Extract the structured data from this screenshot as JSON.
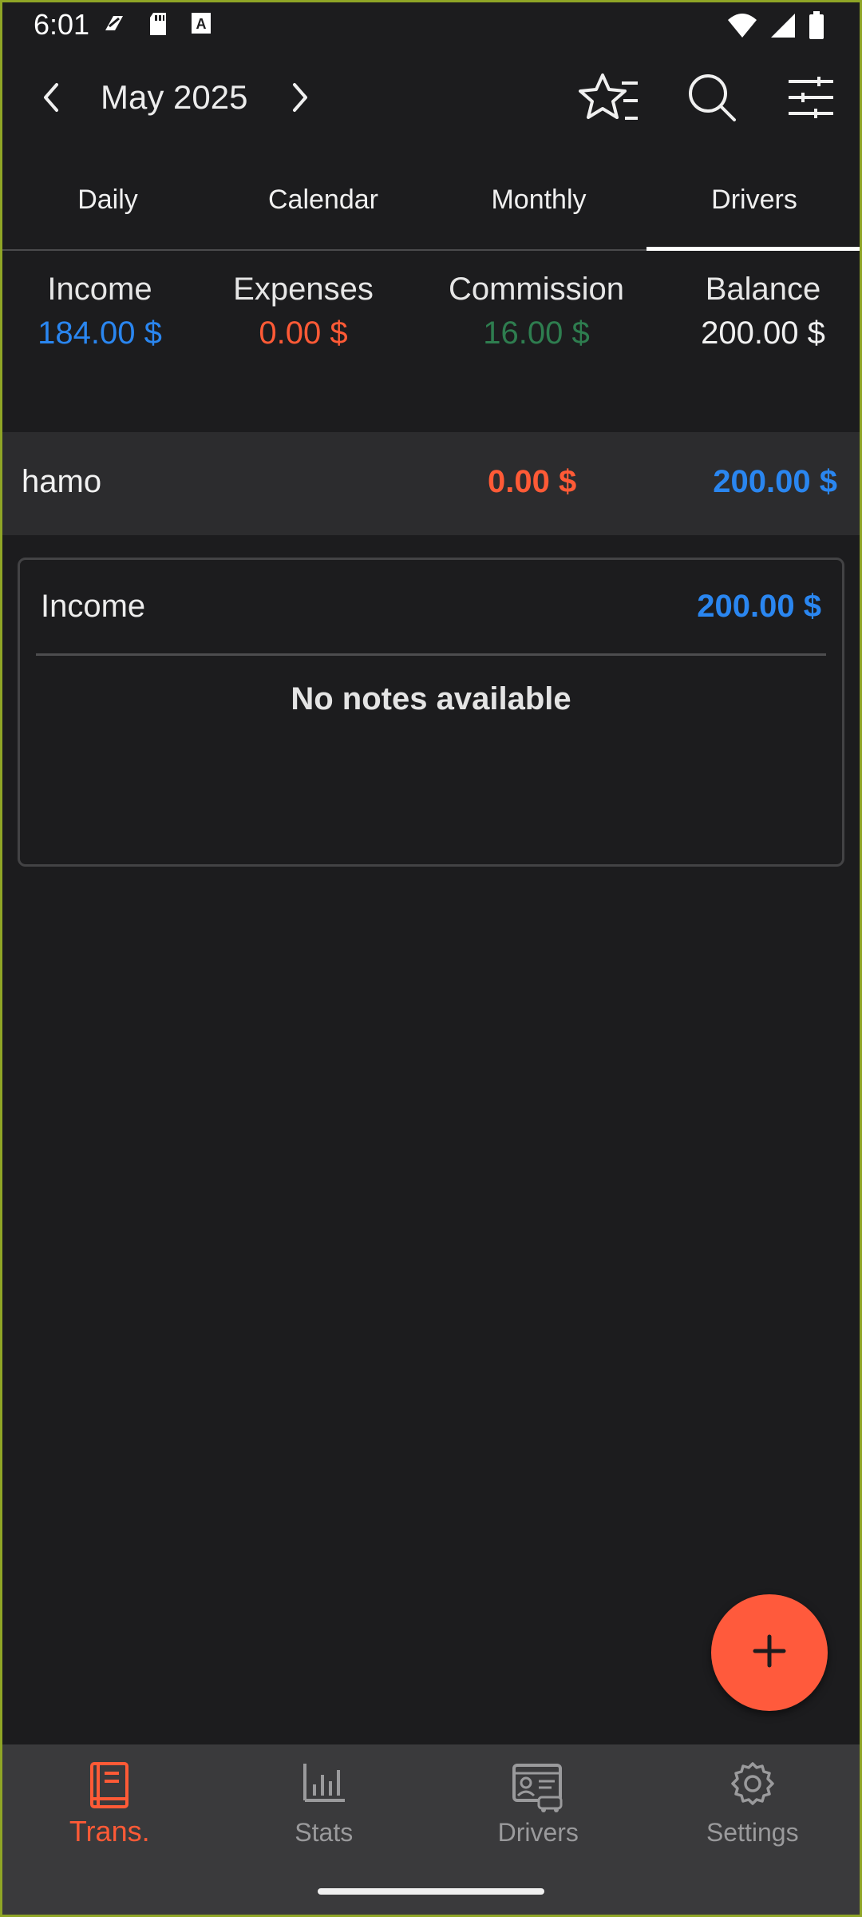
{
  "status_bar": {
    "time": "6:01",
    "left_icons": [
      "nfc-icon",
      "sd-card-icon",
      "a-box-icon"
    ],
    "right_icons": [
      "wifi-icon",
      "cell-signal-icon",
      "battery-icon"
    ]
  },
  "header": {
    "month": "May 2025"
  },
  "tabs": [
    {
      "label": "Daily"
    },
    {
      "label": "Calendar"
    },
    {
      "label": "Monthly"
    },
    {
      "label": "Drivers"
    }
  ],
  "active_tab": "Drivers",
  "summary": {
    "income_label": "Income",
    "income_value": "184.00 $",
    "expenses_label": "Expenses",
    "expenses_value": "0.00 $",
    "commission_label": "Commission",
    "commission_value": "16.00 $",
    "balance_label": "Balance",
    "balance_value": "200.00 $"
  },
  "driver": {
    "name": "hamo",
    "expenses": "0.00 $",
    "income": "200.00 $"
  },
  "card": {
    "title": "Income",
    "value": "200.00 $",
    "note": "No notes available"
  },
  "bottom_nav": [
    {
      "label": "Trans.",
      "icon": "book-icon"
    },
    {
      "label": "Stats",
      "icon": "bar-chart-icon"
    },
    {
      "label": "Drivers",
      "icon": "driver-id-icon"
    },
    {
      "label": "Settings",
      "icon": "gear-icon"
    }
  ],
  "colors": {
    "accent": "#ff5a36",
    "income": "#2a86f0",
    "expense": "#ff5a36",
    "commission": "#2e7d4f",
    "background": "#1c1c1e"
  }
}
